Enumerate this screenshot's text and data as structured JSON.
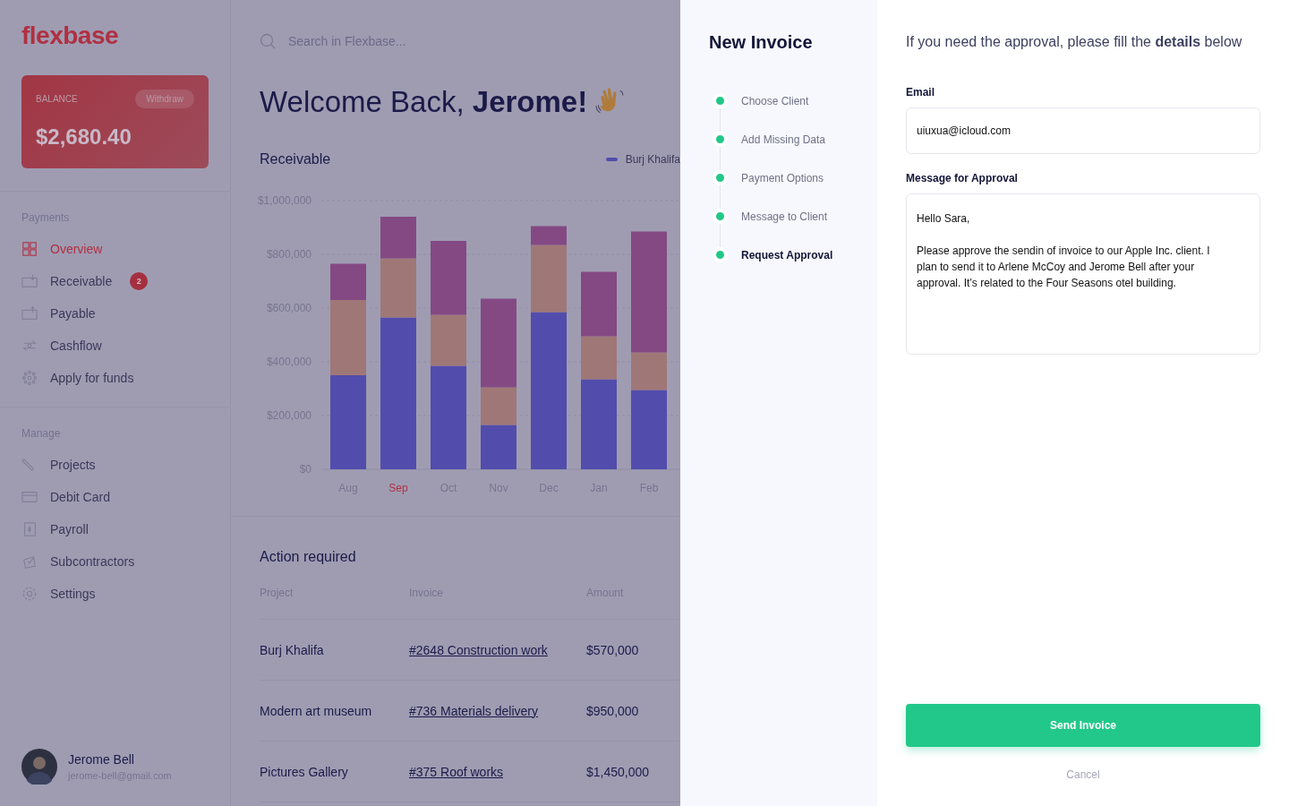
{
  "sidebar": {
    "logo": "flexbase",
    "balance": {
      "label": "BALANCE",
      "action": "Withdraw",
      "amount": "$2,680.40"
    },
    "sections": [
      {
        "title": "Payments",
        "items": [
          {
            "label": "Overview",
            "selected": true
          },
          {
            "label": "Receivable",
            "selected": false,
            "badge": "2"
          },
          {
            "label": "Payable",
            "selected": false
          },
          {
            "label": "Cashflow",
            "selected": false
          },
          {
            "label": "Apply for funds",
            "selected": false
          }
        ]
      },
      {
        "title": "Manage",
        "items": [
          {
            "label": "Projects",
            "selected": false
          },
          {
            "label": "Debit Card",
            "selected": false
          },
          {
            "label": "Payroll",
            "selected": false
          },
          {
            "label": "Subcontractors",
            "selected": false
          },
          {
            "label": "Settings",
            "selected": false
          }
        ]
      }
    ],
    "user": {
      "name": "Jerome Bell",
      "email": "jerome-bell@gmail.com"
    }
  },
  "main": {
    "search": {
      "placeholder": "Search in Flexbase..."
    },
    "greeting": "Welcome Back, **Jerome!**",
    "receivable": {
      "title": "Receivable",
      "category_selected": [
        false,
        true,
        false,
        false,
        false,
        false,
        false
      ],
      "chart_data": {
        "type": "bar",
        "stacked": true,
        "grid": true,
        "categories": [
          "Aug",
          "Sep",
          "Oct",
          "Nov",
          "Dec",
          "Jan",
          "Feb"
        ],
        "ylim": [
          0,
          1000000
        ],
        "yticks": [
          {
            "value": 0,
            "label": "$0"
          },
          {
            "value": 200000,
            "label": "$200,000"
          },
          {
            "value": 400000,
            "label": "$400,000"
          },
          {
            "value": 600000,
            "label": "$600,000"
          },
          {
            "value": 800000,
            "label": "$800,000"
          },
          {
            "value": 1000000,
            "label": "$1,000,000"
          }
        ],
        "series": [
          {
            "name": "Burj Khalifa",
            "color": "#524dac",
            "values": [
              350000,
              565000,
              385000,
              165000,
              585000,
              335000,
              295000
            ]
          },
          {
            "color": "#9f7777",
            "values": [
              280000,
              220000,
              190000,
              140000,
              250000,
              160000,
              140000
            ]
          },
          {
            "color": "#844983",
            "values": [
              135000,
              155000,
              275000,
              330000,
              70000,
              240000,
              450000
            ]
          }
        ]
      }
    },
    "action_required": {
      "title": "Action required",
      "columns": [
        "Project",
        "Invoice",
        "Amount"
      ],
      "rows": [
        {
          "project": "Burj Khalifa",
          "invoice": "#2648 Construction work",
          "amount": "$570,000"
        },
        {
          "project": "Modern art museum",
          "invoice": "#736 Materials delivery",
          "amount": "$950,000"
        },
        {
          "project": "Pictures Gallery",
          "invoice": "#375 Roof works",
          "amount": "$1,450,000"
        }
      ]
    }
  },
  "panel": {
    "title": "New Invoice",
    "steps": [
      {
        "label": "Choose Client",
        "selected": false
      },
      {
        "label": "Add Missing Data",
        "selected": false
      },
      {
        "label": "Payment Options",
        "selected": false
      },
      {
        "label": "Message to Client",
        "selected": false
      },
      {
        "label": "Request Approval",
        "selected": true
      }
    ],
    "intro": "If you need the approval, please fill the **details** below",
    "email": {
      "label": "Email",
      "value": "uiuxua@icloud.com"
    },
    "message": {
      "label": "Message for Approval",
      "value": "Hello Sara,\n\nPlease approve the sendin of invoice to our Apple Inc. client. I plan to send it to Arlene McCoy and Jerome Bell after your approval. It’s related to the Four Seasons otel building."
    },
    "submit": "Send Invoice",
    "cancel": "Cancel"
  }
}
